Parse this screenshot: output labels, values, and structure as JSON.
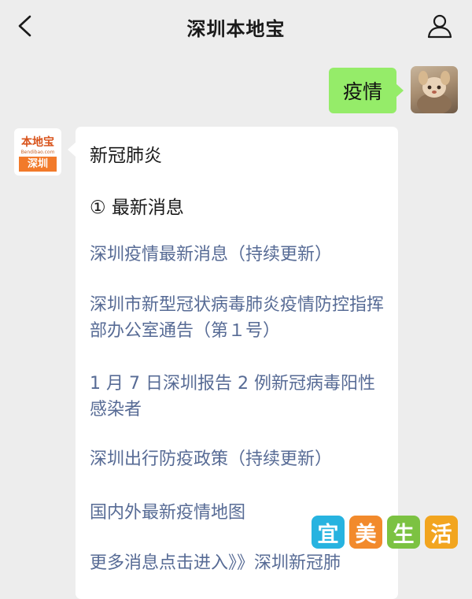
{
  "header": {
    "title": "深圳本地宝"
  },
  "outgoing_message": {
    "text": "疫情"
  },
  "bot": {
    "logo_top": "本地宝",
    "logo_url": "Bendibao.com",
    "logo_bottom": "深圳"
  },
  "reply": {
    "heading": "新冠肺炎",
    "section": "① 最新消息",
    "links": [
      "深圳疫情最新消息（持续更新）",
      "深圳市新型冠状病毒肺炎疫情防控指挥部办公室通告（第１号）",
      "1 月 7 日深圳报告 2 例新冠病毒阳性感染者",
      "深圳出行防疫政策（持续更新）",
      "国内外最新疫情地图",
      "更多消息点击进入》》深圳新冠肺"
    ]
  },
  "watermark": {
    "chars": [
      "宜",
      "美",
      "生",
      "活"
    ],
    "colors": [
      "#27b3e0",
      "#f28a2c",
      "#7cc242",
      "#f2a51f"
    ]
  },
  "colors": {
    "background": "#ededed",
    "sent_bubble": "#95ec69",
    "link": "#576b95"
  }
}
